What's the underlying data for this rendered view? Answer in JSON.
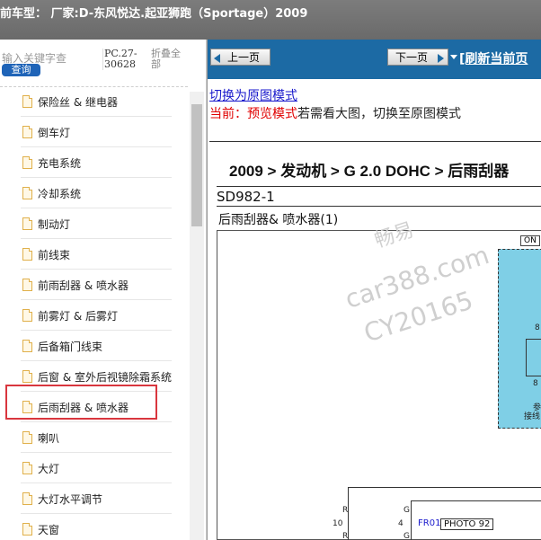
{
  "header": {
    "title": "前车型：  厂家:D-东风悦达.起亚狮跑（Sportage）2009"
  },
  "sidebar": {
    "search_hint": "输入关键字查",
    "search_button": "查询",
    "code": "PC.27-30628",
    "collapse_label": "折叠全部",
    "selected_index": 10,
    "items": [
      {
        "label": "保险丝 & 继电器"
      },
      {
        "label": "倒车灯"
      },
      {
        "label": "充电系统"
      },
      {
        "label": "冷却系统"
      },
      {
        "label": "制动灯"
      },
      {
        "label": "前线束"
      },
      {
        "label": "前雨刮器 & 喷水器"
      },
      {
        "label": "前雾灯 & 后雾灯"
      },
      {
        "label": "后备箱门线束"
      },
      {
        "label": "后窗 & 室外后视镜除霜系统"
      },
      {
        "label": "后雨刮器 & 喷水器"
      },
      {
        "label": "喇叭"
      },
      {
        "label": "大灯"
      },
      {
        "label": "大灯水平调节"
      },
      {
        "label": "天窗"
      }
    ]
  },
  "nav": {
    "prev_label": "上一页",
    "next_label": "下一页",
    "refresh_label": "[刷新当前页"
  },
  "content": {
    "switch_link": "切换为原图模式",
    "current_prefix": "当前：",
    "current_mode": "预览模式",
    "current_suffix": "若需看大图，切换至原图模式",
    "doc_path": "2009 > 发动机 > G 2.0 DOHC > 后雨刮器",
    "doc_code": "SD982-1",
    "doc_title": "后雨刮器& 喷水器(1)",
    "watermark_brand": "畅易",
    "watermark_site": "car388.com",
    "watermark_code": "CY20165",
    "diagram_on": "ON",
    "diagram_texts": [
      "8",
      "8",
      "参",
      "接线"
    ],
    "wire_letters": [
      "R",
      "G",
      "R",
      "G"
    ],
    "wire_numbers": [
      "10",
      "4"
    ],
    "fr_label": "FR01",
    "photo_label": "PHOTO 92"
  },
  "colors": {
    "nav_bg": "#1c6aa4",
    "highlight": "#d9363e",
    "diagram_blue": "#7fcfe6"
  }
}
